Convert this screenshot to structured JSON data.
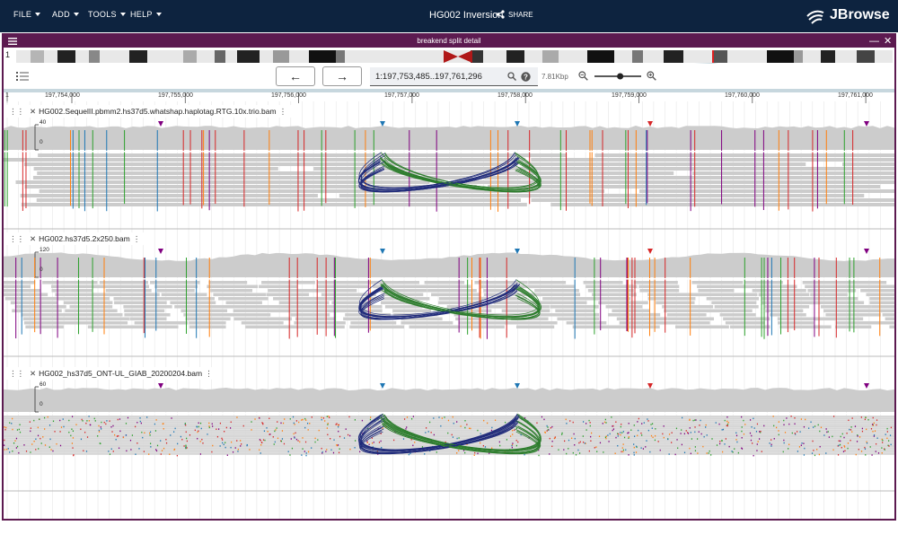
{
  "menu": {
    "items": [
      {
        "label": "FILE"
      },
      {
        "label": "ADD"
      },
      {
        "label": "TOOLS"
      },
      {
        "label": "HELP"
      }
    ]
  },
  "session": {
    "title": "HG002 Inversion",
    "share_label": "SHARE"
  },
  "brand": {
    "name": "JBrowse"
  },
  "view": {
    "title": "breakend split detail",
    "minimize_icon": "minimize-icon",
    "close_icon": "close-icon"
  },
  "overview": {
    "chromosome": "1"
  },
  "nav": {
    "back_icon": "arrow-left-icon",
    "forward_icon": "arrow-right-icon",
    "location": "1:197,753,485..197,761,296",
    "search_icon": "search-icon",
    "help_icon": "help-icon",
    "span": "7.81Kbp",
    "zoom_out_icon": "zoom-out-icon",
    "zoom_in_icon": "zoom-in-icon",
    "zoom_fraction": 0.56
  },
  "ruler": {
    "chrom": "1",
    "ticks": [
      "197,754,000",
      "197,755,000",
      "197,756,000",
      "197,757,000",
      "197,758,000",
      "197,759,000",
      "197,760,000",
      "197,761,000"
    ]
  },
  "tracks": [
    {
      "name": "HG002.SequelII.pbmm2.hs37d5.whatshap.haplotag.RTG.10x.trio.bam",
      "max": "40",
      "min": "0"
    },
    {
      "name": "HG002.hs37d5.2x250.bam",
      "max": "120",
      "min": "0"
    },
    {
      "name": "HG002_hs37d5_ONT-UL_GIAB_20200204.bam",
      "max": "60",
      "min": "0"
    }
  ],
  "colors": {
    "topbar": "#0d233f",
    "view_header": "#5c1a50",
    "read": "#cccccc",
    "arc_left": "#1f2a7a",
    "arc_right": "#2d7d2d",
    "mismatch_A": "#2ca02c",
    "mismatch_C": "#1f77b4",
    "mismatch_G": "#ff7f0e",
    "mismatch_T": "#d62728",
    "insertion": "#800080"
  }
}
